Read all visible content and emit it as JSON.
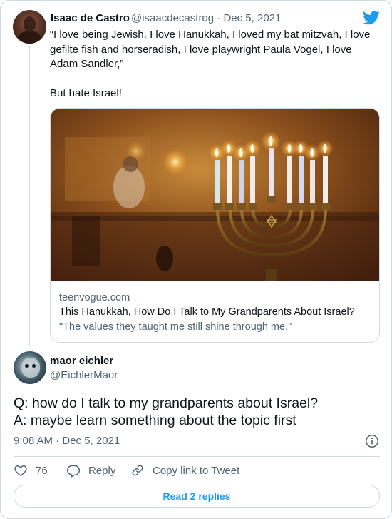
{
  "first_tweet": {
    "author_name": "Isaac de Castro",
    "author_handle": "@isaacdecastrog",
    "separator": "·",
    "date": "Dec 5, 2021",
    "text": "“I love being Jewish. I love Hanukkah, I loved my bat mitzvah, I love gefilte fish and horseradish, I love playwright Paula Vogel, I love Adam Sandler,”\n\nBut hate Israel!",
    "link_card": {
      "domain": "teenvogue.com",
      "title": "This Hanukkah, How Do I Talk to My Grandparents About Israel?",
      "description": "\"The values they taught me still shine through me.\""
    }
  },
  "reply_tweet": {
    "author_name": "maor eichler",
    "author_handle": "@EichlerMaor",
    "text": "Q: how do I talk to my grandparents about Israel?\nA: maybe learn something about the topic first",
    "timestamp": "9:08 AM · Dec 5, 2021"
  },
  "actions": {
    "like_count": "76",
    "reply_label": "Reply",
    "copy_link_label": "Copy link to Tweet"
  },
  "read_replies_label": "Read 2 replies",
  "colors": {
    "twitter_blue": "#1d9bf0",
    "text_primary": "#0f1419",
    "text_secondary": "#536471",
    "border": "#cfd9de"
  },
  "icons": [
    "twitter-logo-icon",
    "info-icon",
    "heart-icon",
    "reply-icon",
    "link-icon"
  ]
}
